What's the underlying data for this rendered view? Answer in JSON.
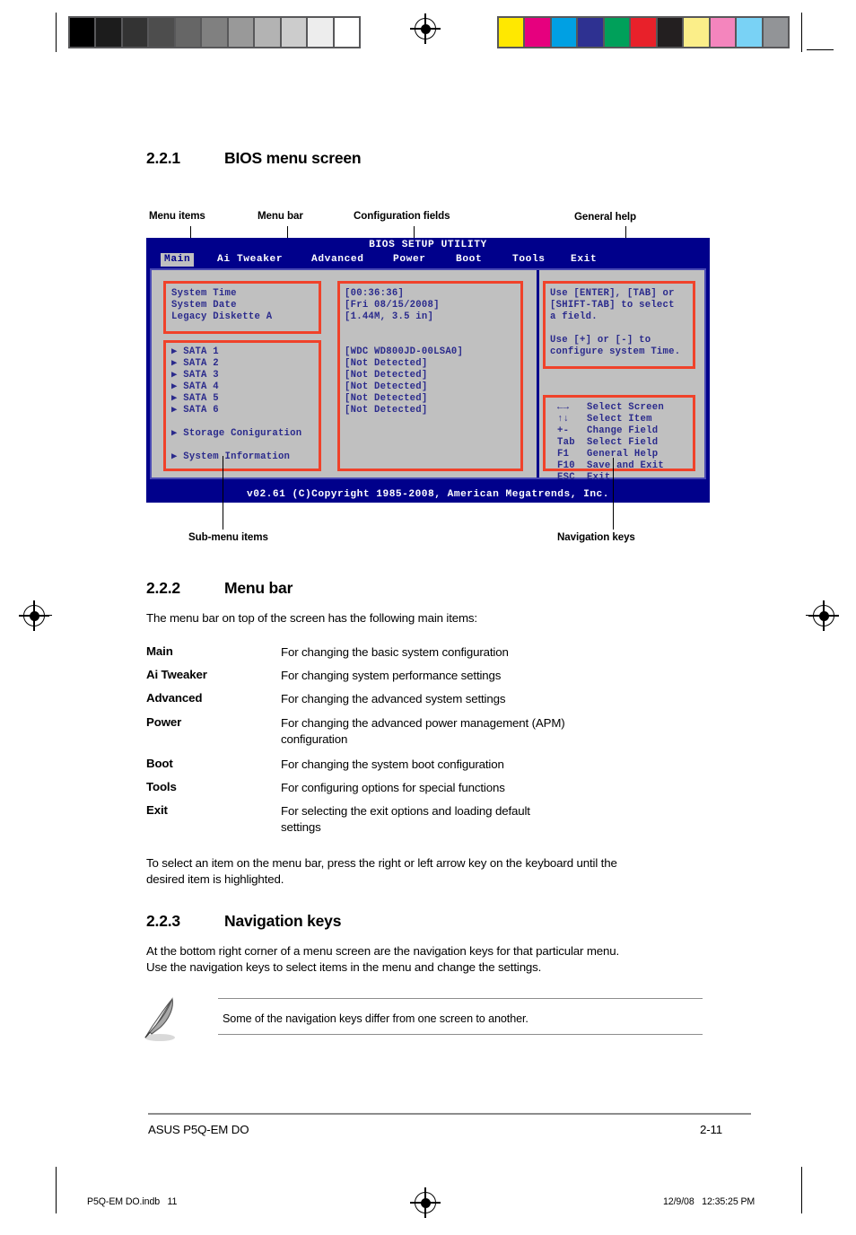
{
  "printmarks": {
    "gray_swatches": [
      "#000000",
      "#1c1c1c",
      "#333333",
      "#4d4d4d",
      "#666666",
      "#808080",
      "#999999",
      "#b3b3b3",
      "#cccccc",
      "#ededed",
      "#ffffff"
    ],
    "color_swatches": [
      "#ffe800",
      "#e6007e",
      "#00a0e3",
      "#2e3191",
      "#00a05a",
      "#e8212a",
      "#231f20",
      "#fbee89",
      "#f485bd",
      "#79d2f5",
      "#929497"
    ]
  },
  "sections": {
    "s221": {
      "number": "2.2.1",
      "title": "BIOS menu screen"
    },
    "s222": {
      "number": "2.2.2",
      "title": "Menu bar"
    },
    "s223": {
      "number": "2.2.3",
      "title": "Navigation keys"
    }
  },
  "callouts": {
    "menu_items": "Menu items",
    "menu_bar": "Menu bar",
    "configuration_fields": "Configuration fields",
    "general_help": "General help",
    "sub_menu_items": "Sub-menu items",
    "navigation_keys": "Navigation keys"
  },
  "bios": {
    "title": "BIOS SETUP UTILITY",
    "menu_bar": [
      {
        "label": "Main",
        "active": true
      },
      {
        "label": "Ai Tweaker",
        "active": false
      },
      {
        "label": "Advanced",
        "active": false
      },
      {
        "label": "Power",
        "active": false
      },
      {
        "label": "Boot",
        "active": false
      },
      {
        "label": "Tools",
        "active": false
      },
      {
        "label": "Exit",
        "active": false
      }
    ],
    "menu_items_block": "System Time\nSystem Date\nLegacy Diskette A",
    "config_fields_block": "[00:36:36]\n[Fri 08/15/2008]\n[1.44M, 3.5 in]",
    "submenu_items_block": "▶ SATA 1\n▶ SATA 2\n▶ SATA 3\n▶ SATA 4\n▶ SATA 5\n▶ SATA 6\n\n▶ Storage Coniguration\n\n▶ System Information",
    "submenu_values_block": "[WDC WD800JD-00LSA0]\n[Not Detected]\n[Not Detected]\n[Not Detected]\n[Not Detected]\n[Not Detected]",
    "general_help_block": "Use [ENTER], [TAB] or\n[SHIFT-TAB] to select\na field.\n\nUse [+] or [-] to\nconfigure system Time.",
    "navigation_keys_block": "←→   Select Screen\n↑↓   Select Item\n+-   Change Field\nTab  Select Field\nF1   General Help\nF10  Save and Exit\nESC  Exit",
    "footer": "v02.61 (C)Copyright 1985-2008, American Megatrends, Inc.",
    "colors": {
      "screen_bg": "#00008b",
      "panel_bg": "#c0c0c0",
      "text": "#2a2a8c",
      "highlight_box": "#f0422a"
    }
  },
  "menubar_section": {
    "intro": "The menu bar on top of the screen has the following main items:",
    "items": [
      {
        "term": "Main",
        "desc": "For changing the basic system configuration"
      },
      {
        "term": "Ai Tweaker",
        "desc": "For changing system performance settings"
      },
      {
        "term": "Advanced",
        "desc": "For changing the advanced system settings"
      },
      {
        "term": "Power",
        "desc": "For changing the advanced power management (APM)\nconfiguration"
      },
      {
        "term": "Boot",
        "desc": "For changing the system boot configuration"
      },
      {
        "term": "Tools",
        "desc": "For configuring options for special functions"
      },
      {
        "term": "Exit",
        "desc": "For selecting the exit options and loading default\nsettings"
      }
    ],
    "outro": "To select an item on the menu bar, press the right or left arrow key on the keyboard until the\ndesired item is highlighted."
  },
  "navkeys_section": {
    "paragraph": "At the bottom right corner of a menu screen are the navigation keys for that particular menu.\nUse the navigation keys to select items in the menu and change the settings.",
    "note": "Some of the navigation keys differ from one screen to another."
  },
  "page_footer": {
    "left": "ASUS P5Q-EM DO",
    "right": "2-11"
  },
  "print_slug": {
    "left": "P5Q-EM DO.indb   11",
    "right": "12/9/08   12:35:25 PM"
  }
}
